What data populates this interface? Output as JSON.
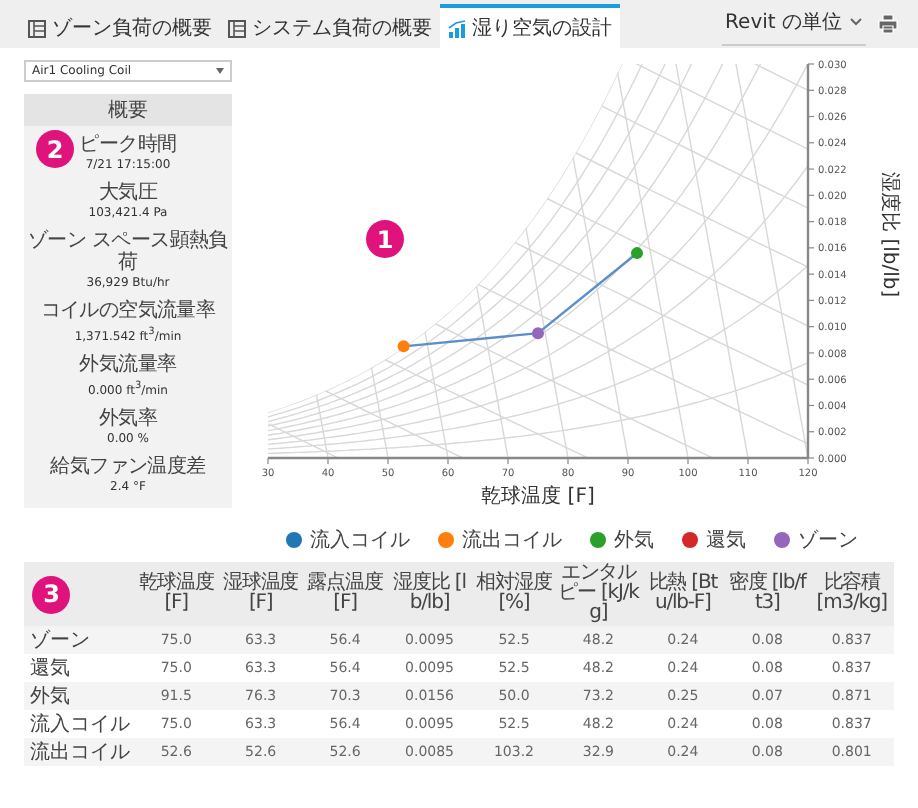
{
  "tabs": [
    {
      "label": "ゾーン負荷の概要",
      "selected": false
    },
    {
      "label": "システム負荷の概要",
      "selected": false
    },
    {
      "label": "湿り空気の設計",
      "selected": true
    }
  ],
  "units": {
    "label": "Revit の単位"
  },
  "coil_select": {
    "value": "Air1 Cooling Coil"
  },
  "summary": {
    "title": "概要",
    "badge": "2",
    "items": [
      {
        "label": "ピーク時間",
        "value": "7/21 17:15:00"
      },
      {
        "label": "大気圧",
        "value": "103,421.4 Pa"
      },
      {
        "label": "ゾーン スペース顕熱負荷",
        "value": "36,929 Btu/hr"
      },
      {
        "label": "コイルの空気流量率",
        "value": "1,371.542 ft$^{3}$/min"
      },
      {
        "label": "外気流量率",
        "value": "0.000 ft$^{3}$/min"
      },
      {
        "label": "外気率",
        "value": "0.00 %"
      },
      {
        "label": "給気ファン温度差",
        "value": "2.4 °F"
      }
    ]
  },
  "chart": {
    "badge": "1",
    "chart_data": {
      "type": "scatter",
      "xlabel": "乾球温度 [F]",
      "ylabel": "湿度比 [lb/lb]",
      "xlim": [
        30,
        120
      ],
      "ylim": [
        0,
        0.03
      ],
      "xticks": [
        30,
        40,
        50,
        60,
        70,
        80,
        90,
        100,
        110,
        120
      ],
      "yticks": [
        {
          "value": 0,
          "label": "0.000"
        },
        {
          "value": 0.002,
          "label": "0.002"
        },
        {
          "value": 0.004,
          "label": "0.004"
        },
        {
          "value": 0.006,
          "label": "0.006"
        },
        {
          "value": 0.008,
          "label": "0.008"
        },
        {
          "value": 0.01,
          "label": "0.010"
        },
        {
          "value": 0.012,
          "label": "0.012"
        },
        {
          "value": 0.014,
          "label": "0.014"
        },
        {
          "value": 0.016,
          "label": "0.016"
        },
        {
          "value": 0.018,
          "label": "0.018"
        },
        {
          "value": 0.02,
          "label": "0.020"
        },
        {
          "value": 0.022,
          "label": "0.022"
        },
        {
          "value": 0.024,
          "label": "0.024"
        },
        {
          "value": 0.026,
          "label": "0.026"
        },
        {
          "value": 0.028,
          "label": "0.028"
        },
        {
          "value": 0.03,
          "label": "0.030"
        }
      ],
      "series": [
        {
          "type": "line",
          "color": "#5b8fc9",
          "x": [
            52.6,
            75.0,
            91.5
          ],
          "values": [
            0.0085,
            0.0095,
            0.0156
          ]
        },
        {
          "name": "流入コイル",
          "color": "#1f77b4",
          "x": [
            null
          ],
          "values": [
            null
          ]
        },
        {
          "name": "流出コイル",
          "color": "#ff7f0e",
          "x": [
            52.6
          ],
          "values": [
            0.0085
          ]
        },
        {
          "name": "外気",
          "color": "#2ca02c",
          "x": [
            91.5
          ],
          "values": [
            0.0156
          ]
        },
        {
          "name": "還気",
          "color": "#d62728",
          "x": [
            null
          ],
          "values": [
            null
          ]
        },
        {
          "name": "ゾーン",
          "color": "#9467bd",
          "x": [
            75.0
          ],
          "values": [
            0.0095
          ]
        }
      ]
    }
  },
  "table": {
    "badge": "3",
    "columns": [
      "乾球温度 [F]",
      "湿球温度 [F]",
      "露点温度 [F]",
      "湿度比 [lb/lb]",
      "相対湿度 [%]",
      "エンタルピー [kJ/kg]",
      "比熱 [Btu/lb-F]",
      "密度 [lb/ft3]",
      "比容積 [m3/kg]"
    ],
    "rows": [
      {
        "name": "ゾーン",
        "cells": [
          "75.0",
          "63.3",
          "56.4",
          "0.0095",
          "52.5",
          "48.2",
          "0.24",
          "0.08",
          "0.837"
        ]
      },
      {
        "name": "還気",
        "cells": [
          "75.0",
          "63.3",
          "56.4",
          "0.0095",
          "52.5",
          "48.2",
          "0.24",
          "0.08",
          "0.837"
        ]
      },
      {
        "name": "外気",
        "cells": [
          "91.5",
          "76.3",
          "70.3",
          "0.0156",
          "50.0",
          "73.2",
          "0.25",
          "0.07",
          "0.871"
        ]
      },
      {
        "name": "流入コイル",
        "cells": [
          "75.0",
          "63.3",
          "56.4",
          "0.0095",
          "52.5",
          "48.2",
          "0.24",
          "0.08",
          "0.837"
        ]
      },
      {
        "name": "流出コイル",
        "cells": [
          "52.6",
          "52.6",
          "52.6",
          "0.0085",
          "103.2",
          "32.9",
          "0.24",
          "0.08",
          "0.801"
        ]
      }
    ]
  }
}
